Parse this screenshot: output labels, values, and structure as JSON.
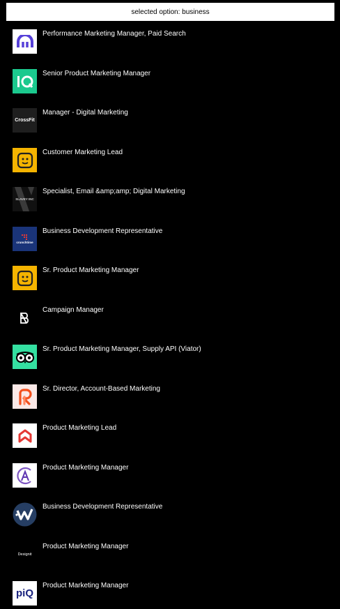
{
  "header": {
    "label": "selected option: business"
  },
  "jobs": [
    {
      "title": "Performance Marketing Manager, Paid Search",
      "logo": "kraken-logo-icon"
    },
    {
      "title": "Senior Product Marketing Manager",
      "logo": "iq-logo-icon"
    },
    {
      "title": "Manager - Digital Marketing",
      "logo": "crossfit-logo-icon",
      "logo_text": "CrossFit"
    },
    {
      "title": "Customer Marketing Lead",
      "logo": "smiley-box-logo-icon"
    },
    {
      "title": "Specialist, Email &amp;amp; Digital Marketing",
      "logo": "slavey-logo-icon",
      "logo_text": "SLAVEY INC"
    },
    {
      "title": "Business Development Representative",
      "logo": "crunchtime-logo-icon",
      "logo_text": "crunchtime"
    },
    {
      "title": "Sr. Product Marketing Manager",
      "logo": "smiley-box-logo-icon"
    },
    {
      "title": "Campaign Manager",
      "logo": "b-letter-logo-icon"
    },
    {
      "title": "Sr. Product Marketing Manager, Supply API (Viator)",
      "logo": "tripadvisor-owl-logo-icon"
    },
    {
      "title": "Sr. Director, Account-Based Marketing",
      "logo": "r-arrow-logo-icon"
    },
    {
      "title": "Product Marketing Lead",
      "logo": "chevron-stack-logo-icon"
    },
    {
      "title": "Product Marketing Manager",
      "logo": "a-circle-logo-icon"
    },
    {
      "title": "Business Development Representative",
      "logo": "w-circle-logo-icon"
    },
    {
      "title": "Product Marketing Manager",
      "logo": "designit-logo-icon",
      "logo_text": "Designit"
    },
    {
      "title": "Product Marketing Manager",
      "logo": "piq-logo-icon",
      "logo_text": "piQ"
    }
  ]
}
